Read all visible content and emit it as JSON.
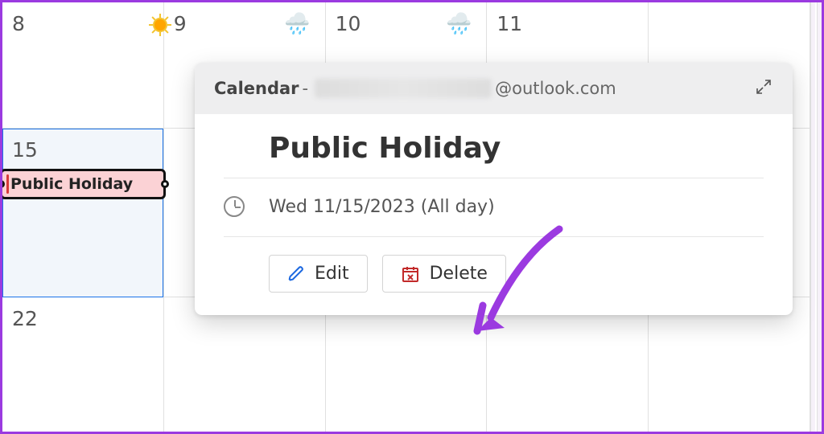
{
  "calendar": {
    "row1": [
      {
        "day": "8",
        "weather": "sunny"
      },
      {
        "day": "9",
        "weather": "rain"
      },
      {
        "day": "10",
        "weather": "rain"
      },
      {
        "day": "11",
        "weather": null
      }
    ],
    "row2_day": "15",
    "row3_day": "22",
    "event_label": "Public Holiday"
  },
  "popup": {
    "calendar_label": "Calendar",
    "separator": " - ",
    "email_suffix": "@outlook.com",
    "title": "Public Holiday",
    "datetime": "Wed 11/15/2023 (All day)",
    "edit_label": "Edit",
    "delete_label": "Delete"
  }
}
